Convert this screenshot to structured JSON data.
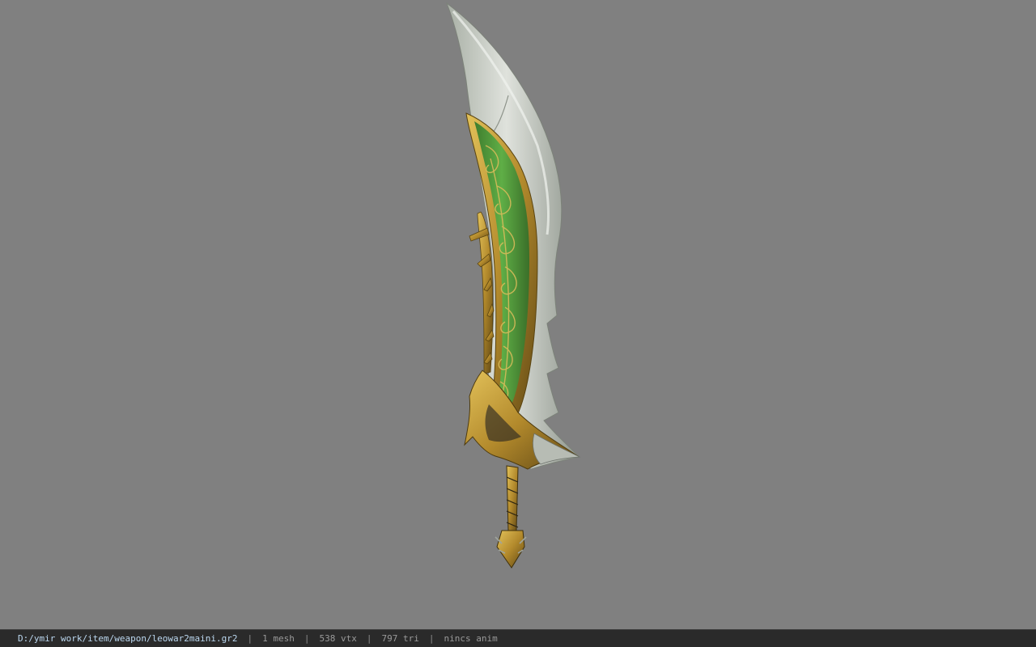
{
  "viewport": {
    "background_color": "#808080",
    "model": {
      "icon": "sword-model",
      "colors": {
        "blade": "#d2d6cf",
        "blade_shadow": "#9ea59c",
        "inlay": "#4f9a3c",
        "gold": "#c9a441",
        "gold_dark": "#6e5418"
      }
    }
  },
  "status_bar": {
    "file_path": "D:/ymir work/item/weapon/leowar2maini.gr2",
    "separator": "|",
    "mesh_count": "1 mesh",
    "vertex_count": "538 vtx",
    "triangle_count": "797 tri",
    "animation": "nincs anim"
  }
}
